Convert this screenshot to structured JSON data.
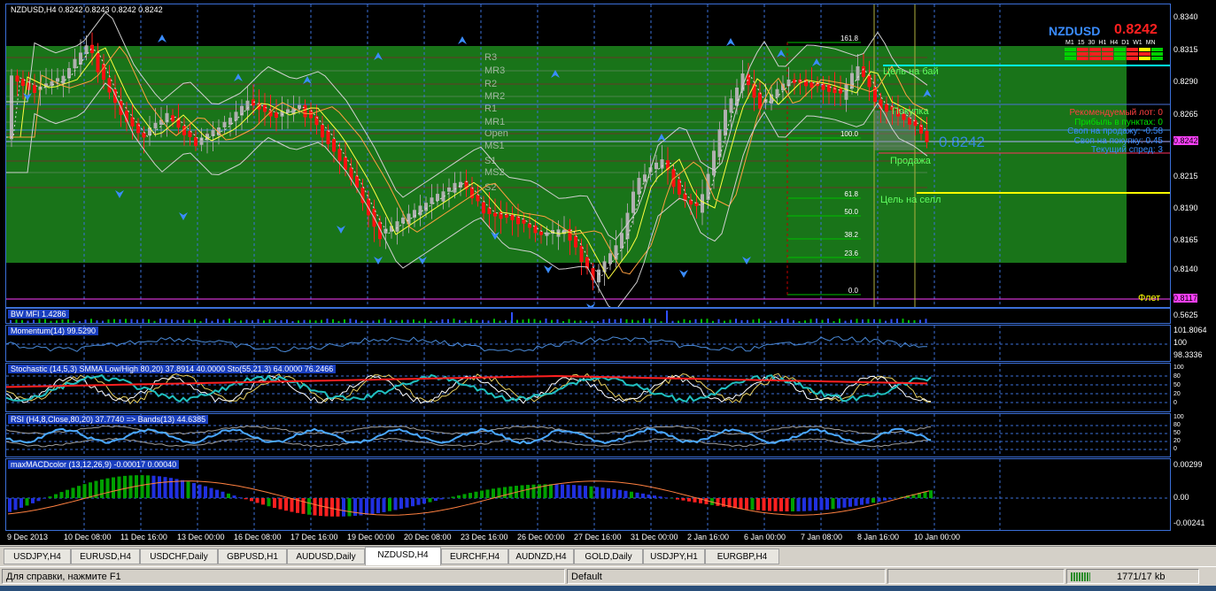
{
  "main_chart": {
    "header": "NZDUSD,H4  0.8242 0.8243 0.8242 0.8242",
    "symbol": "NZDUSD",
    "price": "0.8242",
    "tf_labels": [
      "M1",
      "15",
      "30",
      "H1",
      "H4",
      "D1",
      "W1",
      "MN"
    ],
    "pivot_labels": [
      "R3",
      "MR3",
      "R2",
      "MR2",
      "R1",
      "MR1",
      "Open",
      "MS1",
      "S1",
      "MS2",
      "S2"
    ],
    "fib_labels": [
      "161.8",
      "100.0",
      "61.8",
      "50.0",
      "38.2",
      "23.6",
      "0.0"
    ],
    "zone_labels": {
      "buy_target": "Цель на бай",
      "buy": "Покупка",
      "sell": "Продажа",
      "sell_target": "Цель на селл",
      "flat": "Флет"
    },
    "big_price": "0.8242",
    "info_lines": [
      {
        "text": "Рекомендуемый лот: 0",
        "color": "#ff4040"
      },
      {
        "text": "Прибыль в пунктах: 0",
        "color": "#00e000"
      },
      {
        "text": "Своп на продажу: -0.58",
        "color": "#3a8cff"
      },
      {
        "text": "Своп на покупку: 0.45",
        "color": "#3a8cff"
      },
      {
        "text": "Текущий спред: 3",
        "color": "#3a8cff"
      }
    ],
    "axis": [
      "0.8340",
      "0.8315",
      "0.8290",
      "0.8265",
      "0.8242",
      "0.8215",
      "0.8190",
      "0.8165",
      "0.8140",
      "0.8117"
    ]
  },
  "indicators": {
    "bwmfi": {
      "label": "BW MFI 1.4286",
      "axis": [
        "0.5625"
      ]
    },
    "momentum": {
      "label": "Momentum(14) 99.5290",
      "axis": [
        "101.8064",
        "100",
        "98.3336"
      ]
    },
    "stochastic": {
      "label": "Stochastic (14,5,3) SMMA Low/High 80,20) 37.8914 40.0000  Sto(55,21,3) 64.0000 76.2466",
      "axis": [
        "100",
        "80",
        "50",
        "20",
        "0"
      ]
    },
    "rsi": {
      "label": "RSI (H4,8,Close,80,20) 37.7740  => Bands(13) 44.6385",
      "axis": [
        "100",
        "80",
        "50",
        "20",
        "0"
      ]
    },
    "macd": {
      "label": "maxMACDcolor (13,12,26,9) -0.00017 0.00040",
      "axis": [
        "0.00299",
        "0.00",
        "-0.00241"
      ]
    }
  },
  "time_axis": [
    "9 Dec 2013",
    "10 Dec 08:00",
    "11 Dec 16:00",
    "13 Dec 00:00",
    "16 Dec 08:00",
    "17 Dec 16:00",
    "19 Dec 00:00",
    "20 Dec 08:00",
    "23 Dec 16:00",
    "26 Dec 00:00",
    "27 Dec 16:00",
    "31 Dec 00:00",
    "2 Jan 16:00",
    "6 Jan 00:00",
    "7 Jan 08:00",
    "8 Jan 16:00",
    "10 Jan 00:00"
  ],
  "tabs": [
    "USDJPY,H4",
    "EURUSD,H4",
    "USDCHF,Daily",
    "GBPUSD,H1",
    "AUDUSD,Daily",
    "NZDUSD,H4",
    "EURCHF,H4",
    "AUDNZD,H4",
    "GOLD,Daily",
    "USDJPY,H1",
    "EURGBP,H4"
  ],
  "active_tab": "NZDUSD,H4",
  "status": {
    "help": "Для справки, нажмите F1",
    "profile": "Default",
    "traffic": "1771/17 kb"
  }
}
